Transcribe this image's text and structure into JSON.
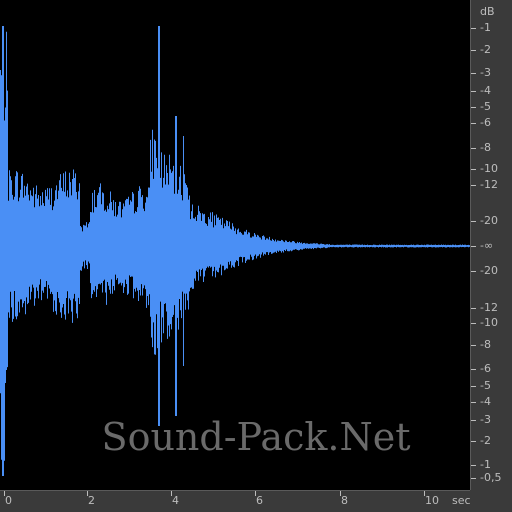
{
  "waveform": {
    "color": "#4a8ff5",
    "background": "#000000"
  },
  "db_ruler": {
    "unit": "dB",
    "labels": [
      "-1",
      "-2",
      "-3",
      "-4",
      "-5",
      "-6",
      "-8",
      "-10",
      "-12",
      "-20",
      "-∞",
      "-20",
      "-12",
      "-10",
      "-8",
      "-6",
      "-5",
      "-4",
      "-3",
      "-2",
      "-1",
      "-0,5"
    ]
  },
  "time_ruler": {
    "labels": [
      "0",
      "2",
      "4",
      "6",
      "8",
      "10"
    ],
    "unit": "sec"
  },
  "watermark": {
    "text": "Sound-Pack.Net"
  }
}
